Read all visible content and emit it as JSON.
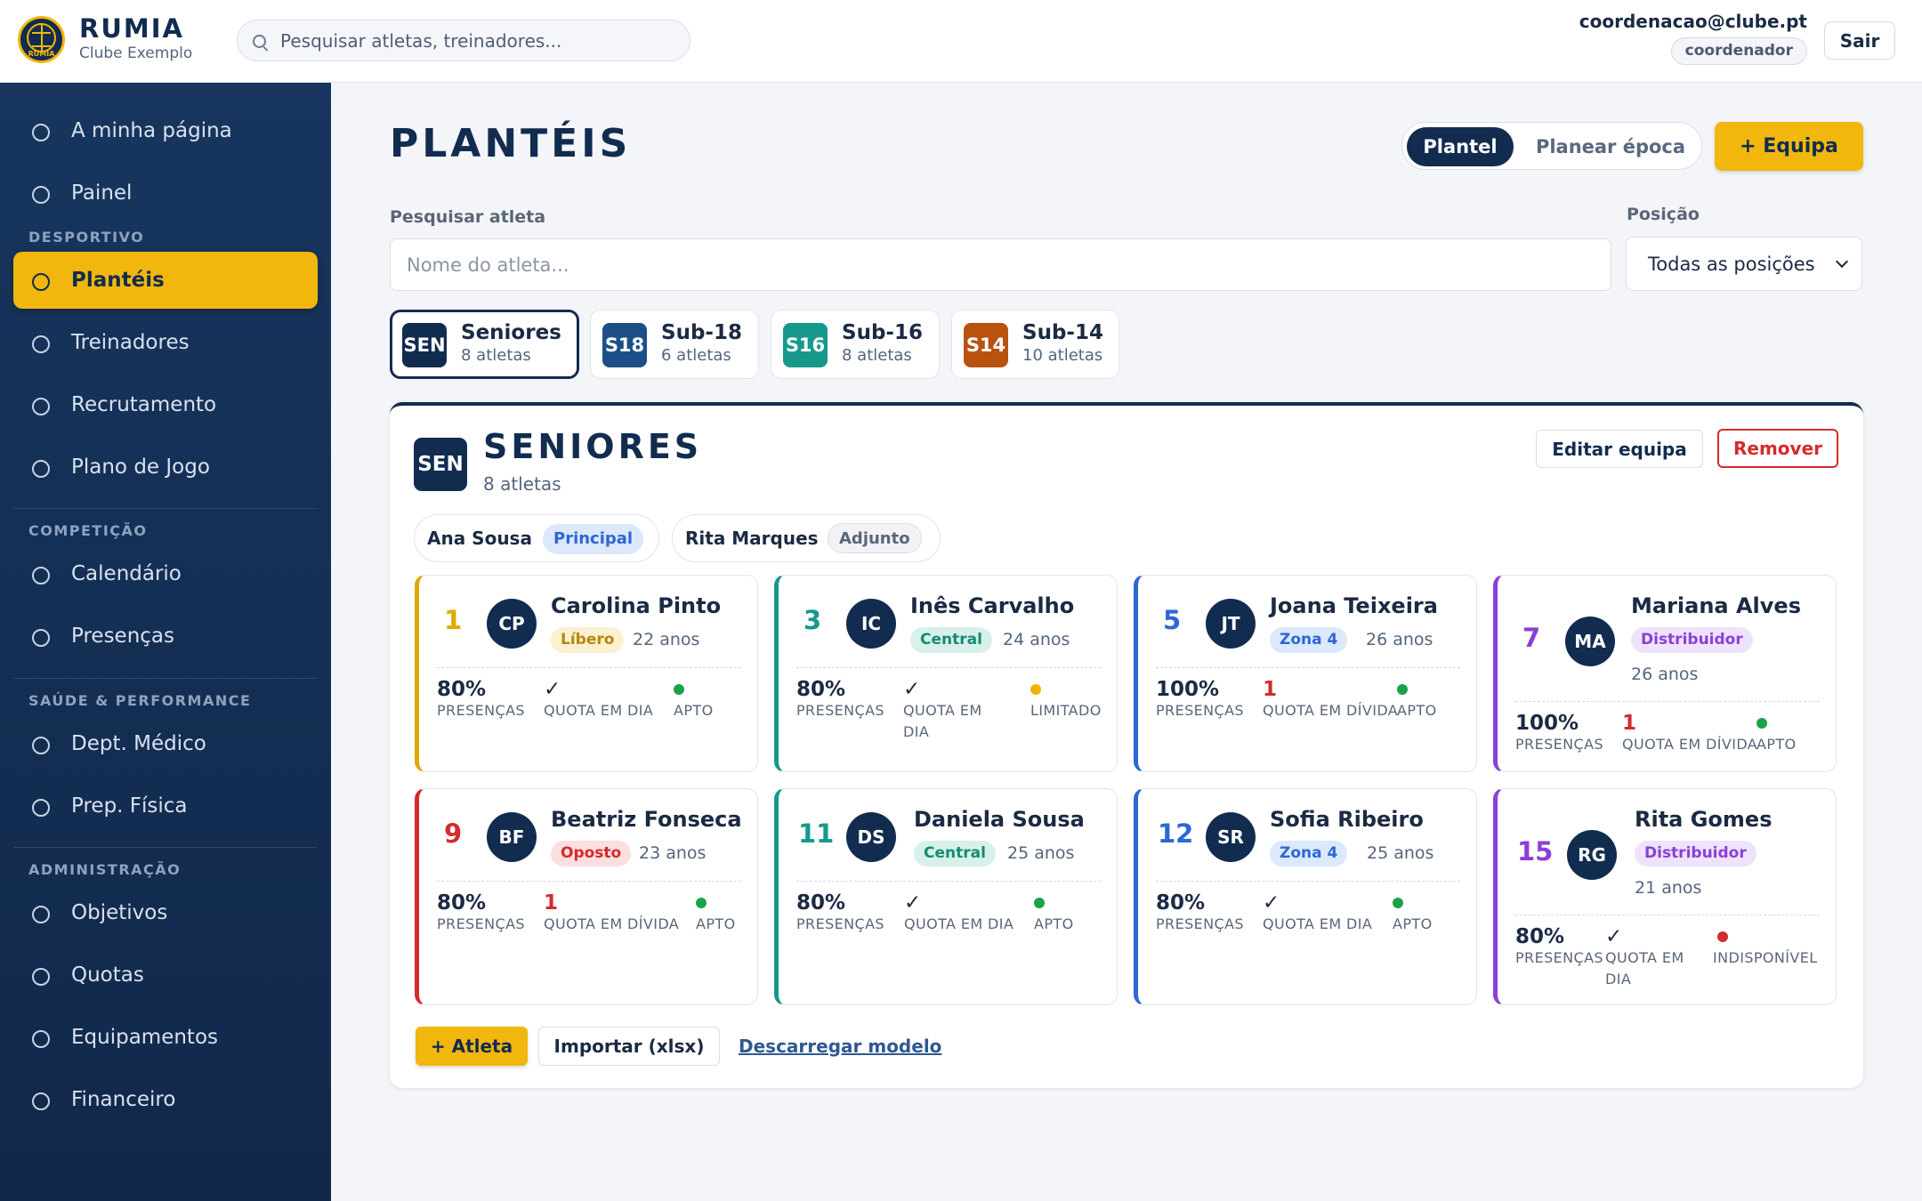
{
  "brand": {
    "name": "RUMIA",
    "subtitle": "Clube Exemplo",
    "logo_text": "RUMIA"
  },
  "search": {
    "placeholder": "Pesquisar atletas, treinadores..."
  },
  "user": {
    "email": "coordenacao@clube.pt",
    "role": "coordenador",
    "logout_label": "Sair"
  },
  "sidebar": {
    "top_items": [
      {
        "label": "A minha página",
        "icon": "circle-icon"
      },
      {
        "label": "Painel",
        "icon": "circle-icon"
      }
    ],
    "sections": [
      {
        "title": "DESPORTIVO",
        "items": [
          {
            "label": "Plantéis",
            "active": true
          },
          {
            "label": "Treinadores"
          },
          {
            "label": "Recrutamento"
          },
          {
            "label": "Plano de Jogo"
          }
        ]
      },
      {
        "title": "COMPETIÇÃO",
        "items": [
          {
            "label": "Calendário"
          },
          {
            "label": "Presenças"
          }
        ]
      },
      {
        "title": "SAÚDE & PERFORMANCE",
        "items": [
          {
            "label": "Dept. Médico"
          },
          {
            "label": "Prep. Física"
          }
        ]
      },
      {
        "title": "ADMINISTRAÇÃO",
        "items": [
          {
            "label": "Objetivos"
          },
          {
            "label": "Quotas"
          },
          {
            "label": "Equipamentos"
          },
          {
            "label": "Financeiro"
          }
        ]
      }
    ]
  },
  "page": {
    "title": "PLANTÉIS",
    "view_toggle": {
      "active": "Plantel",
      "inactive": "Planear época"
    },
    "add_team_label": "+ Equipa",
    "athlete_search_label": "Pesquisar atleta",
    "athlete_search_placeholder": "Nome do atleta...",
    "position_label": "Posição",
    "position_value": "Todas as posições"
  },
  "teams": [
    {
      "code": "SEN",
      "name": "Seniores",
      "count": "8 atletas",
      "color": "#122c50",
      "selected": true
    },
    {
      "code": "S18",
      "name": "Sub-18",
      "count": "6 atletas",
      "color": "#1d4f86"
    },
    {
      "code": "S16",
      "name": "Sub-16",
      "count": "8 atletas",
      "color": "#16998a"
    },
    {
      "code": "S14",
      "name": "Sub-14",
      "count": "10 atletas",
      "color": "#b9510f"
    }
  ],
  "panel": {
    "badge": "SEN",
    "title": "SENIORES",
    "subtitle": "8 atletas",
    "edit_label": "Editar equipa",
    "remove_label": "Remover",
    "coaches": [
      {
        "name": "Ana Sousa",
        "role": "Principal"
      },
      {
        "name": "Rita Marques",
        "role": "Adjunto"
      }
    ],
    "stat_labels": {
      "attendance": "PRESENÇAS",
      "fee_ok": "QUOTA EM DIA",
      "fee_debt": "QUOTA EM DÍVIDA"
    },
    "players": [
      {
        "number": "1",
        "initials": "CP",
        "name": "Carolina Pinto",
        "position": "Líbero",
        "age": "22 anos",
        "attendance": "80%",
        "fee": "✓",
        "fee_label": "QUOTA EM DIA",
        "status": "APTO",
        "accent": "#e0a800",
        "status_color": "#1aa34a"
      },
      {
        "number": "3",
        "initials": "IC",
        "name": "Inês Carvalho",
        "position": "Central",
        "age": "24 anos",
        "attendance": "80%",
        "fee": "✓",
        "fee_label": "QUOTA EM DIA",
        "status": "LIMITADO",
        "accent": "#16998a",
        "status_color": "#f0b400"
      },
      {
        "number": "5",
        "initials": "JT",
        "name": "Joana Teixeira",
        "position": "Zona 4",
        "age": "26 anos",
        "attendance": "100%",
        "fee": "1",
        "fee_label": "QUOTA EM DÍVIDA",
        "status": "APTO",
        "accent": "#2e66d4",
        "status_color": "#1aa34a"
      },
      {
        "number": "7",
        "initials": "MA",
        "name": "Mariana Alves",
        "position": "Distribuidor",
        "age": "26 anos",
        "attendance": "100%",
        "fee": "1",
        "fee_label": "QUOTA EM DÍVIDA",
        "status": "APTO",
        "accent": "#8a3fd9",
        "status_color": "#1aa34a"
      },
      {
        "number": "9",
        "initials": "BF",
        "name": "Beatriz Fonseca",
        "position": "Oposto",
        "age": "23 anos",
        "attendance": "80%",
        "fee": "1",
        "fee_label": "QUOTA EM DÍVIDA",
        "status": "APTO",
        "accent": "#d42b2b",
        "status_color": "#1aa34a"
      },
      {
        "number": "11",
        "initials": "DS",
        "name": "Daniela Sousa",
        "position": "Central",
        "age": "25 anos",
        "attendance": "80%",
        "fee": "✓",
        "fee_label": "QUOTA EM DIA",
        "status": "APTO",
        "accent": "#16998a",
        "status_color": "#1aa34a"
      },
      {
        "number": "12",
        "initials": "SR",
        "name": "Sofia Ribeiro",
        "position": "Zona 4",
        "age": "25 anos",
        "attendance": "80%",
        "fee": "✓",
        "fee_label": "QUOTA EM DIA",
        "status": "APTO",
        "accent": "#2e66d4",
        "status_color": "#1aa34a"
      },
      {
        "number": "15",
        "initials": "RG",
        "name": "Rita Gomes",
        "position": "Distribuidor",
        "age": "21 anos",
        "attendance": "80%",
        "fee": "✓",
        "fee_label": "QUOTA EM DIA",
        "status": "INDISPONÍVEL",
        "accent": "#8a3fd9",
        "status_color": "#d42b2b"
      }
    ],
    "add_athlete_label": "+ Atleta",
    "import_label": "Importar (xlsx)",
    "template_link_label": "Descarregar modelo"
  }
}
